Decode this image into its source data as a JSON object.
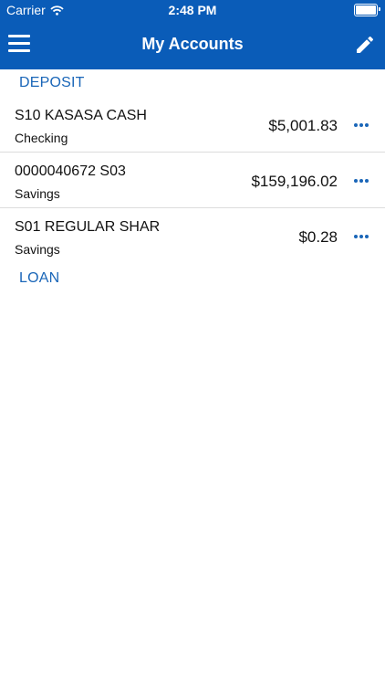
{
  "status_bar": {
    "carrier": "Carrier",
    "time": "2:48 PM"
  },
  "header": {
    "title": "My Accounts"
  },
  "sections": {
    "deposit": {
      "label": "DEPOSIT"
    },
    "loan": {
      "label": "LOAN"
    }
  },
  "accounts": [
    {
      "name": "S10 KASASA CASH",
      "type": "Checking",
      "balance": "$5,001.83"
    },
    {
      "name": "0000040672 S03",
      "type": "Savings",
      "balance": "$159,196.02"
    },
    {
      "name": "S01 REGULAR SHAR",
      "type": "Savings",
      "balance": "$0.28"
    }
  ],
  "colors": {
    "header_bg": "#0a5cb8",
    "accent": "#1a66b8",
    "divider": "#dcdcdc"
  },
  "icons": [
    "wifi-icon",
    "battery-icon",
    "menu-icon",
    "pencil-icon",
    "more-icon"
  ]
}
